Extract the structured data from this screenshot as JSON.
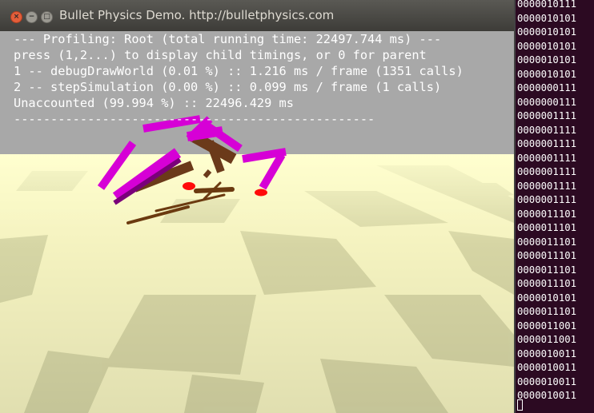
{
  "window": {
    "title": "Bullet Physics Demo. http://bulletphysics.com",
    "buttons": {
      "close": "×",
      "minimize": "−",
      "maximize": "□"
    }
  },
  "profiling": {
    "lines": [
      "--- Profiling: Root (total running time: 22497.744 ms) ---",
      "press (1,2...) to display child timings, or 0 for parent",
      "1 -- debugDrawWorld (0.01 %) :: 1.216 ms / frame (1351 calls)",
      "2 -- stepSimulation (0.00 %) :: 0.099 ms / frame (1 calls)",
      "Unaccounted (99.994 %) :: 22496.429 ms",
      "-------------------------------------------------"
    ]
  },
  "terminal": {
    "lines": [
      "0000010111",
      "0000010101",
      "0000010101",
      "0000010101",
      "0000010101",
      "0000010101",
      "0000000111",
      "0000000111",
      "0000001111",
      "0000001111",
      "0000001111",
      "0000001111",
      "0000001111",
      "0000001111",
      "0000001111",
      "0000011101",
      "0000011101",
      "0000011101",
      "0000011101",
      "0000011101",
      "0000011101",
      "0000010101",
      "0000011101",
      "0000011001",
      "0000011001",
      "0000010011",
      "0000010011",
      "0000010011",
      "0000010011"
    ]
  },
  "colors": {
    "sky": "#a9a9a9",
    "floor_light": "#ffffcc",
    "floor_dark": "#d9d9a8",
    "limb": "#d400d4",
    "body": "#6b3a1a",
    "foot": "#ff0000",
    "terminal_bg": "#2c0a22",
    "titlebar": "#4a4944"
  }
}
